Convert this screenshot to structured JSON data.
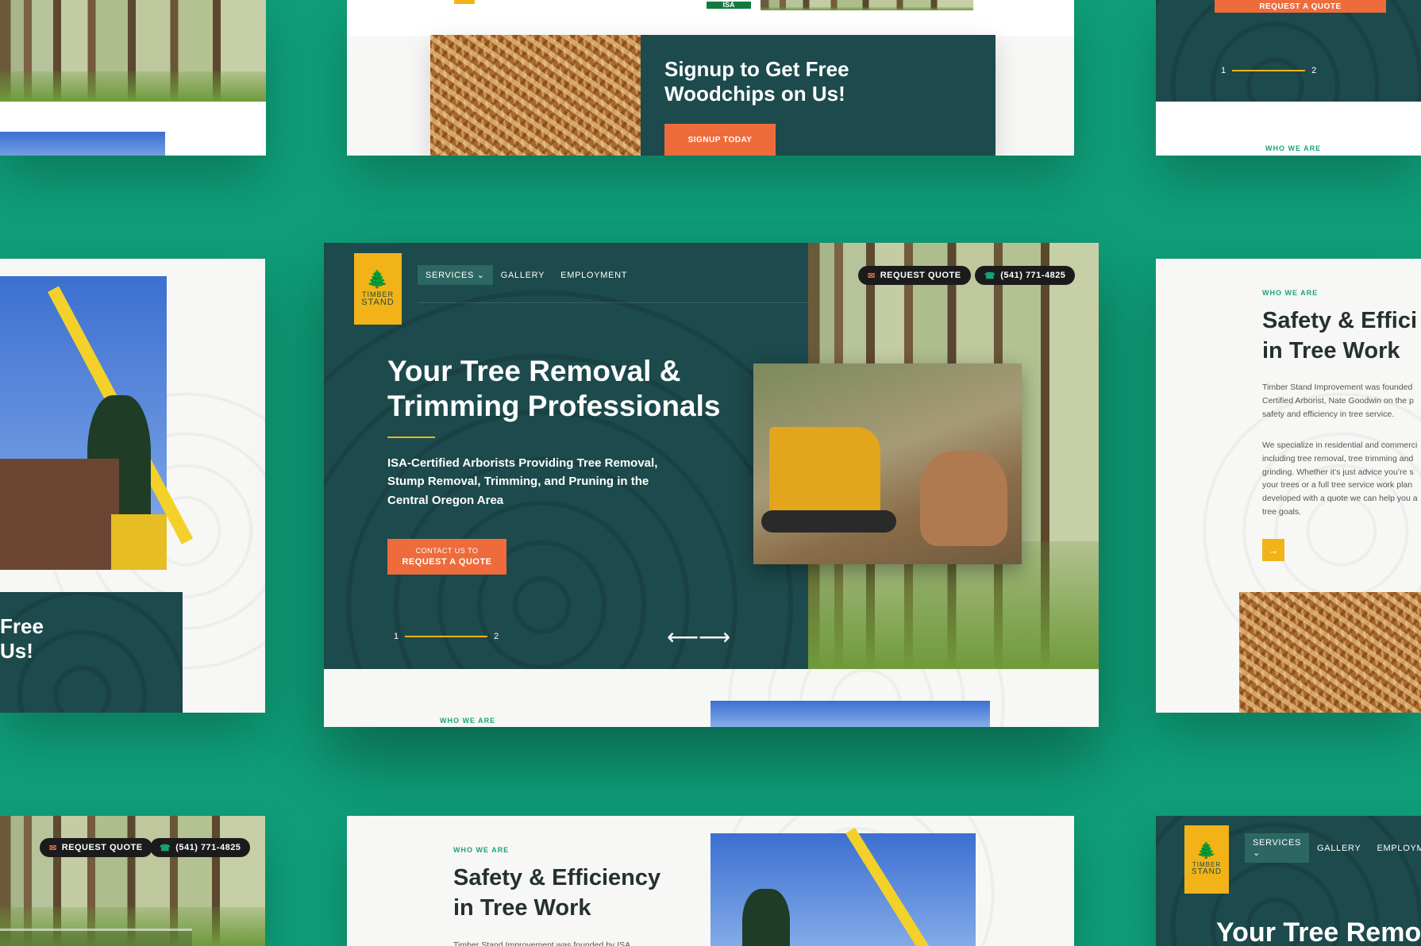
{
  "brand": {
    "name_top": "TIMBER",
    "name_bottom": "STAND",
    "logo_icon": "pine-trees-icon",
    "colors": {
      "background": "#0f9e78",
      "dark_teal": "#1d4a4c",
      "orange": "#ee6b3b",
      "gold": "#f2b318",
      "green_label": "#1aa476"
    }
  },
  "nav": {
    "services": "SERVICES",
    "gallery": "GALLERY",
    "employment": "EMPLOYMENT",
    "employment_partial": "EMPLOYMENT"
  },
  "header_actions": {
    "request_quote": "REQUEST QUOTE",
    "phone": "(541) 771-4825",
    "request_a_quote_partial": "REQUEST A QUOTE"
  },
  "hero": {
    "title_line1": "Your Tree Removal &",
    "title_line2": "Trimming Professionals",
    "subtitle": "ISA-Certified Arborists Providing Tree Removal, Stump Removal, Trimming, and Pruning in the Central Oregon Area",
    "cta_small": "CONTACT US TO",
    "cta_large": "REQUEST A QUOTE",
    "slide_start": "1",
    "slide_end": "2",
    "prev_arrow": "⟵",
    "next_arrow": "⟶",
    "partial_title": "Your Tree Remo"
  },
  "signup": {
    "title_line1": "Signup to Get Free",
    "title_line2": "Woodchips on Us!",
    "button": "SIGNUP TODAY",
    "partial_line1": "Free",
    "partial_line2": "Us!"
  },
  "about": {
    "eyebrow": "WHO WE ARE",
    "title_line1": "Safety & Efficiency",
    "title_line2": "in Tree Work",
    "partial_title_line1": "Safety & Effici",
    "paragraph1_lines": [
      "Timber Stand Improvement was founded",
      "Certified Arborist, Nate Goodwin on the p",
      "safety and efficiency in tree service."
    ],
    "paragraph2_lines": [
      "We specialize in residential and commerci",
      "including tree removal, tree trimming and",
      "grinding. Whether it’s just advice you’re s",
      "your trees or a full tree service work plan",
      "developed with a quote we can help you a",
      "tree goals."
    ],
    "partial_body": "Timber Stand Improvement was founded by ISA",
    "arrow_button": "→"
  },
  "isa_badge": "ISA"
}
